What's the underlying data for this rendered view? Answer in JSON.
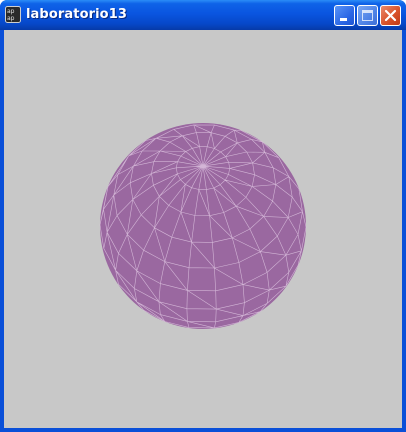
{
  "window": {
    "title": "laboratorio13",
    "app_icon": "processing-app-icon",
    "controls": {
      "minimize": "minimize-icon",
      "maximize": "maximize-icon",
      "close": "close-icon"
    }
  },
  "canvas": {
    "background": "#c8c8c8",
    "object": "wireframe-sphere",
    "fill_color": "#9a68a0",
    "stroke_color": "#e6cfe8"
  }
}
